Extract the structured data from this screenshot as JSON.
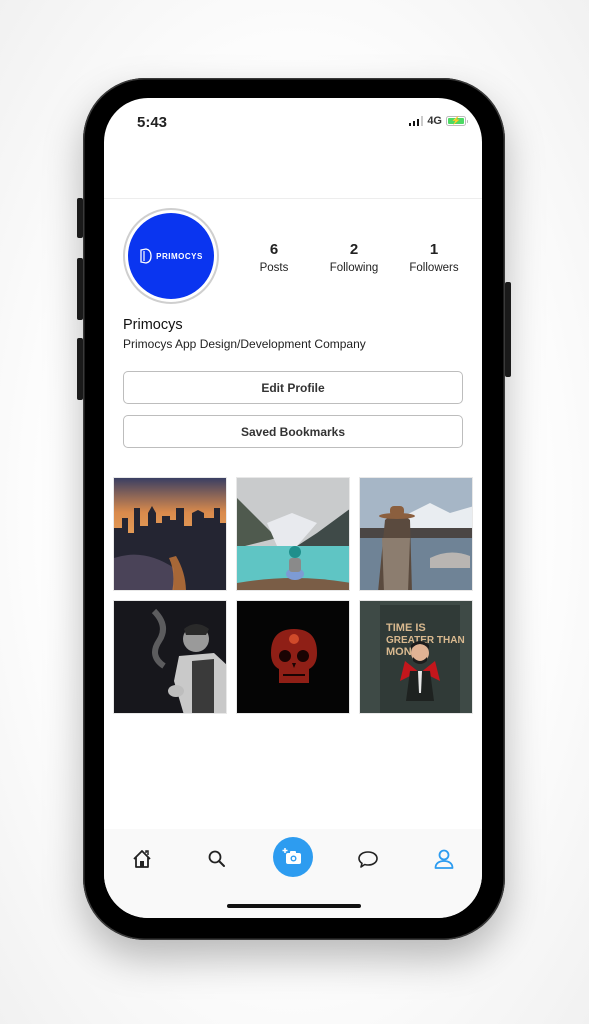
{
  "status_bar": {
    "time": "5:43",
    "network": "4G",
    "battery_charging": true,
    "battery_color": "#4cd964"
  },
  "profile": {
    "avatar_logo_text": "PRIMOCYS",
    "avatar_bg_color": "#0a35f0",
    "name": "Primocys",
    "bio": "Primocys App Design/Development Company",
    "stats": [
      {
        "value": "6",
        "label": "Posts"
      },
      {
        "value": "2",
        "label": "Following"
      },
      {
        "value": "1",
        "label": "Followers"
      }
    ],
    "buttons": {
      "edit_profile": "Edit Profile",
      "saved_bookmarks": "Saved Bookmarks"
    }
  },
  "posts": [
    {
      "subject": "city-skyline-sunset"
    },
    {
      "subject": "woman-by-mountain-lake"
    },
    {
      "subject": "woman-with-hat-by-lake"
    },
    {
      "subject": "man-smoking-bw"
    },
    {
      "subject": "red-sugar-skull"
    },
    {
      "subject": "time-is-greater-than-money-poster",
      "caption": "TIME IS GREATER THAN MONEY."
    }
  ],
  "tab_bar": {
    "items": [
      {
        "icon": "home-icon",
        "active": false
      },
      {
        "icon": "search-icon",
        "active": false
      },
      {
        "icon": "add-photo-icon",
        "active": false
      },
      {
        "icon": "chat-icon",
        "active": false
      },
      {
        "icon": "profile-icon",
        "active": true
      }
    ],
    "accent_color": "#2d9cf0"
  }
}
